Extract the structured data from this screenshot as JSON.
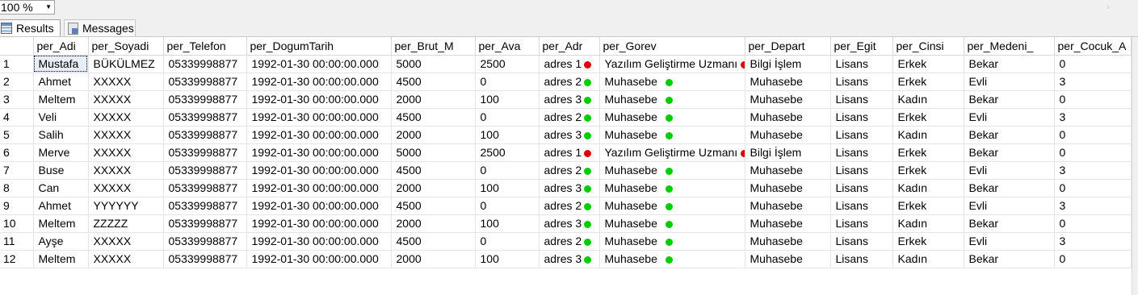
{
  "zoom": {
    "value": "100 %"
  },
  "tabs": [
    {
      "label": "Results"
    },
    {
      "label": "Messages"
    }
  ],
  "colors": {
    "red": "#e00000",
    "green": "#00cc00"
  },
  "columns": [
    "per_Adi",
    "per_Soyadi",
    "per_Telefon",
    "per_DogumTarih",
    "per_Brut_M",
    "per_Ava",
    "per_Adr",
    "per_Gorev",
    "per_Depart",
    "per_Egit",
    "per_Cinsi",
    "per_Medeni_",
    "per_Cocuk_A"
  ],
  "rows": [
    {
      "n": "1",
      "ad": "Mustafa",
      "soyad": "BÜKÜLMEZ",
      "tel": "05339998877",
      "dogum": "1992-01-30 00:00:00.000",
      "brut": "5000",
      "ava": "2500",
      "adr": "adres 1",
      "gorev": "Yazılım Geliştirme Uzmanı",
      "depart": "Bilgi İşlem",
      "egit": "Lisans",
      "cinsi": "Erkek",
      "medeni": "Bekar",
      "cocuk": "0",
      "status": "red"
    },
    {
      "n": "2",
      "ad": "Ahmet",
      "soyad": "XXXXX",
      "tel": "05339998877",
      "dogum": "1992-01-30 00:00:00.000",
      "brut": "4500",
      "ava": "0",
      "adr": "adres 2",
      "gorev": "Muhasebe",
      "depart": "Muhasebe",
      "egit": "Lisans",
      "cinsi": "Erkek",
      "medeni": "Evli",
      "cocuk": "3",
      "status": "green"
    },
    {
      "n": "3",
      "ad": "Meltem",
      "soyad": "XXXXX",
      "tel": "05339998877",
      "dogum": "1992-01-30 00:00:00.000",
      "brut": "2000",
      "ava": "100",
      "adr": "adres 3",
      "gorev": "Muhasebe",
      "depart": "Muhasebe",
      "egit": "Lisans",
      "cinsi": "Kadın",
      "medeni": "Bekar",
      "cocuk": "0",
      "status": "green"
    },
    {
      "n": "4",
      "ad": "Veli",
      "soyad": "XXXXX",
      "tel": "05339998877",
      "dogum": "1992-01-30 00:00:00.000",
      "brut": "4500",
      "ava": "0",
      "adr": "adres 2",
      "gorev": "Muhasebe",
      "depart": "Muhasebe",
      "egit": "Lisans",
      "cinsi": "Erkek",
      "medeni": "Evli",
      "cocuk": "3",
      "status": "green"
    },
    {
      "n": "5",
      "ad": "Salih",
      "soyad": "XXXXX",
      "tel": "05339998877",
      "dogum": "1992-01-30 00:00:00.000",
      "brut": "2000",
      "ava": "100",
      "adr": "adres 3",
      "gorev": "Muhasebe",
      "depart": "Muhasebe",
      "egit": "Lisans",
      "cinsi": "Kadın",
      "medeni": "Bekar",
      "cocuk": "0",
      "status": "green"
    },
    {
      "n": "6",
      "ad": "Merve",
      "soyad": "XXXXX",
      "tel": "05339998877",
      "dogum": "1992-01-30 00:00:00.000",
      "brut": "5000",
      "ava": "2500",
      "adr": "adres 1",
      "gorev": "Yazılım Geliştirme Uzmanı",
      "depart": "Bilgi İşlem",
      "egit": "Lisans",
      "cinsi": "Erkek",
      "medeni": "Bekar",
      "cocuk": "0",
      "status": "red"
    },
    {
      "n": "7",
      "ad": "Buse",
      "soyad": "XXXXX",
      "tel": "05339998877",
      "dogum": "1992-01-30 00:00:00.000",
      "brut": "4500",
      "ava": "0",
      "adr": "adres 2",
      "gorev": "Muhasebe",
      "depart": "Muhasebe",
      "egit": "Lisans",
      "cinsi": "Erkek",
      "medeni": "Evli",
      "cocuk": "3",
      "status": "green"
    },
    {
      "n": "8",
      "ad": "Can",
      "soyad": "XXXXX",
      "tel": "05339998877",
      "dogum": "1992-01-30 00:00:00.000",
      "brut": "2000",
      "ava": "100",
      "adr": "adres 3",
      "gorev": "Muhasebe",
      "depart": "Muhasebe",
      "egit": "Lisans",
      "cinsi": "Kadın",
      "medeni": "Bekar",
      "cocuk": "0",
      "status": "green"
    },
    {
      "n": "9",
      "ad": "Ahmet",
      "soyad": "YYYYYY",
      "tel": "05339998877",
      "dogum": "1992-01-30 00:00:00.000",
      "brut": "4500",
      "ava": "0",
      "adr": "adres 2",
      "gorev": "Muhasebe",
      "depart": "Muhasebe",
      "egit": "Lisans",
      "cinsi": "Erkek",
      "medeni": "Evli",
      "cocuk": "3",
      "status": "green"
    },
    {
      "n": "10",
      "ad": "Meltem",
      "soyad": "ZZZZZ",
      "tel": "05339998877",
      "dogum": "1992-01-30 00:00:00.000",
      "brut": "2000",
      "ava": "100",
      "adr": "adres 3",
      "gorev": "Muhasebe",
      "depart": "Muhasebe",
      "egit": "Lisans",
      "cinsi": "Kadın",
      "medeni": "Bekar",
      "cocuk": "0",
      "status": "green"
    },
    {
      "n": "11",
      "ad": "Ayşe",
      "soyad": "XXXXX",
      "tel": "05339998877",
      "dogum": "1992-01-30 00:00:00.000",
      "brut": "4500",
      "ava": "0",
      "adr": "adres 2",
      "gorev": "Muhasebe",
      "depart": "Muhasebe",
      "egit": "Lisans",
      "cinsi": "Erkek",
      "medeni": "Evli",
      "cocuk": "3",
      "status": "green"
    },
    {
      "n": "12",
      "ad": "Meltem",
      "soyad": "XXXXX",
      "tel": "05339998877",
      "dogum": "1992-01-30 00:00:00.000",
      "brut": "2000",
      "ava": "100",
      "adr": "adres 3",
      "gorev": "Muhasebe",
      "depart": "Muhasebe",
      "egit": "Lisans",
      "cinsi": "Kadın",
      "medeni": "Bekar",
      "cocuk": "0",
      "status": "green"
    }
  ]
}
